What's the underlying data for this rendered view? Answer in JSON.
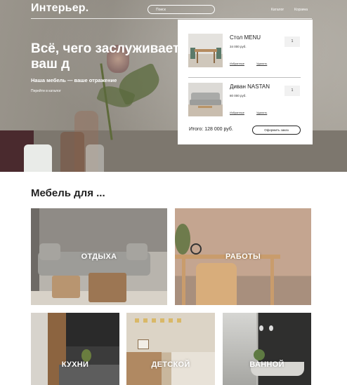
{
  "header": {
    "logo": "Интерьер.",
    "search_placeholder": "Поиск",
    "nav": [
      "Каталог",
      "Корзина"
    ]
  },
  "hero": {
    "title": "Всё, чего заслуживает ваш д",
    "subtitle": "Наша мебель — ваше отражение",
    "link": "Перейти в каталог"
  },
  "cart": {
    "items": [
      {
        "name": "Стол MENU",
        "price": "34 000 руб.",
        "qty": "1",
        "fav_label": "Избранные",
        "remove_label": "Удалить",
        "image_icon": "dining-table-photo"
      },
      {
        "name": "Диван NASTAN",
        "price": "80 000 руб.",
        "qty": "1",
        "fav_label": "Избранные",
        "remove_label": "Удалить",
        "image_icon": "sofa-photo"
      }
    ],
    "total": "Итого: 128 000 руб.",
    "checkout_label": "Оформить заказ"
  },
  "categories": {
    "title": "Мебель для ...",
    "tiles": [
      "ОТДЫХА",
      "РАБОТЫ",
      "КУХНИ",
      "ДЕТСКОЙ",
      "ВАННОЙ"
    ]
  },
  "colors": {
    "text_dark": "#222222",
    "hero_bg": "#9a958c",
    "white": "#ffffff"
  }
}
